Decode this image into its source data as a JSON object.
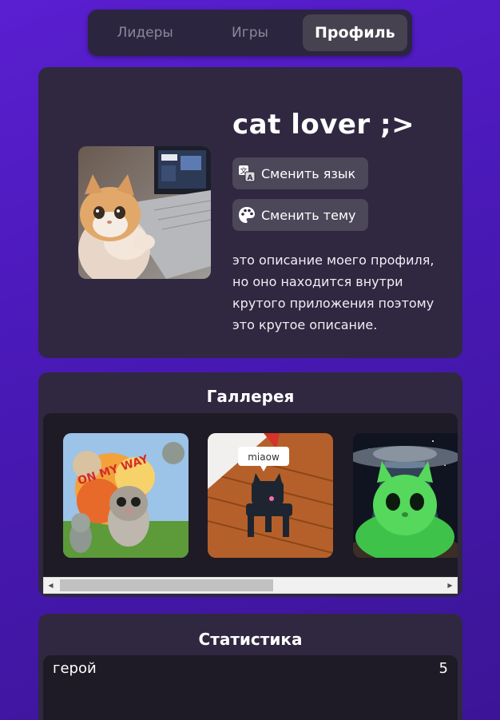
{
  "tabs": [
    {
      "label": "Лидеры",
      "active": false
    },
    {
      "label": "Игры",
      "active": false
    },
    {
      "label": "Профиль",
      "active": true
    }
  ],
  "profile": {
    "username": "cat lover ;>",
    "avatar_icon": "cat-at-laptop-photo",
    "change_language_label": "Сменить язык",
    "change_language_icon": "translate-icon",
    "change_theme_label": "Сменить тему",
    "change_theme_icon": "palette-icon",
    "description": "это описание моего профиля, но оно находится внутри крутого приложения поэтому это крутое описание."
  },
  "gallery": {
    "title": "Галлерея",
    "items": [
      {
        "icon": "cat-explosion-meme",
        "caption": "ON MY WAY"
      },
      {
        "icon": "cat-on-stool-meme",
        "caption": "miaow"
      },
      {
        "icon": "green-alien-cat-meme",
        "caption": ""
      }
    ]
  },
  "stats": {
    "title": "Статистика",
    "rows": [
      {
        "name": "герой",
        "value": "5"
      }
    ]
  },
  "colors": {
    "background": "#5a1fd1",
    "card": "#2f2840",
    "tab_bar": "#2c2540",
    "active_tab": "#47424f",
    "button": "#4c4759",
    "inner_panel": "#1e1b26"
  }
}
